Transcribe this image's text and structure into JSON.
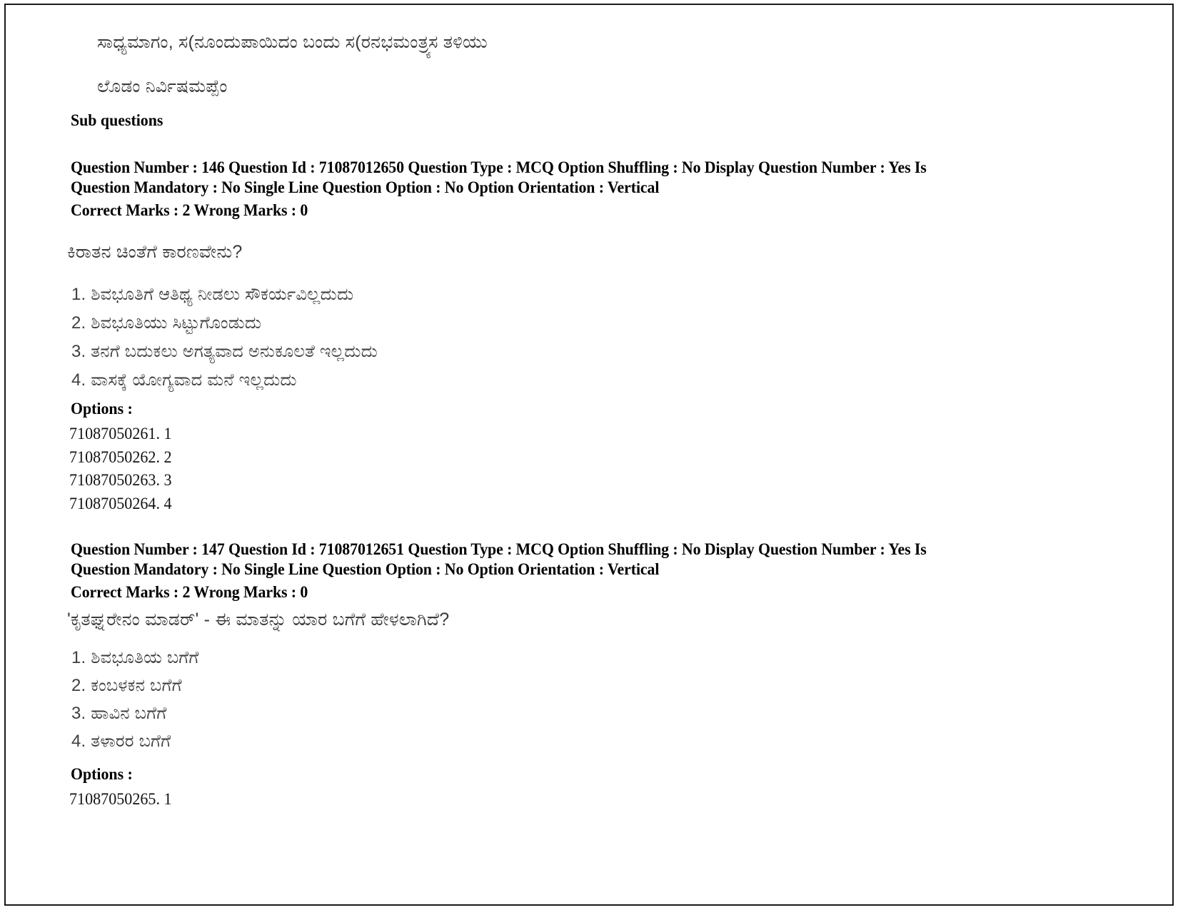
{
  "document": {
    "type": "exam-question-paper-scan",
    "language_primary": "Kannada",
    "language_secondary": "English"
  },
  "passage_tail": {
    "line1": "ಸಾಧ್ಯಮಾಗಂ, ಸ(ನೂಂದುಪಾಯಿದಂ ಬಂದು ಸ(ರನಭಮಂತ್ರ್ಯಸ ತಳಿಯು",
    "line2": "ಲೊಡಂ ನಿರ್ವಿಷಮಪ್ಪೆಂ"
  },
  "sub_questions_heading": "Sub questions",
  "questions": [
    {
      "meta_line1": "Question Number : 146 Question Id : 71087012650 Question Type : MCQ Option Shuffling : No Display Question Number : Yes Is",
      "meta_line2": "Question Mandatory : No Single Line Question Option : No Option Orientation : Vertical",
      "marks_line": "Correct Marks : 2 Wrong Marks : 0",
      "stem": "ಕಿರಾತನ ಚಿಂತೆಗೆ ಕಾರಣವೇನು?",
      "choices": [
        "1. ಶಿವಭೂತಿಗೆ ಆತಿಥ್ಯ ನೀಡಲು ಸೌಕರ್ಯವಿಲ್ಲದುದು",
        "2. ಶಿವಭೂತಿಯು ಸಿಟ್ಟುಗೊಂಡುದು",
        "3. ತನಗೆ ಬದುಕಲು ಅಗತ್ಯವಾದ ಅನುಕೂಲತೆ ಇಲ್ಲದುದು",
        "4. ವಾಸಕ್ಕೆ ಯೋಗ್ಯವಾದ ಮನೆ ಇಲ್ಲದುದು"
      ],
      "options_label": "Options :",
      "option_ids": [
        "71087050261. 1",
        "71087050262. 2",
        "71087050263. 3",
        "71087050264. 4"
      ]
    },
    {
      "meta_line1": "Question Number : 147 Question Id : 71087012651 Question Type : MCQ Option Shuffling : No Display Question Number : Yes Is",
      "meta_line2": "Question Mandatory : No Single Line Question Option : No Option Orientation : Vertical",
      "marks_line": "Correct Marks : 2 Wrong Marks : 0",
      "stem": "'ಕೃತಘ್ನರೇನಂ ಮಾಡರ್' - ಈ ಮಾತನ್ನು ಯಾರ ಬಗೆಗೆ ಹೇಳಲಾಗಿದೆ?",
      "choices": [
        "1. ಶಿವಭೂತಿಯ ಬಗೆಗೆ",
        "2. ಕಂಬಳಕನ ಬಗೆಗೆ",
        "3. ಹಾವಿನ ಬಗೆಗೆ",
        "4. ತಳಾರರ ಬಗೆಗೆ"
      ],
      "options_label": "Options :",
      "option_ids": [
        "71087050265. 1"
      ]
    }
  ],
  "colors": {
    "page_background": "#ffffff",
    "border": "#1a1a1a",
    "english_text": "#000000",
    "kannada_text": "#3a3a3a"
  }
}
